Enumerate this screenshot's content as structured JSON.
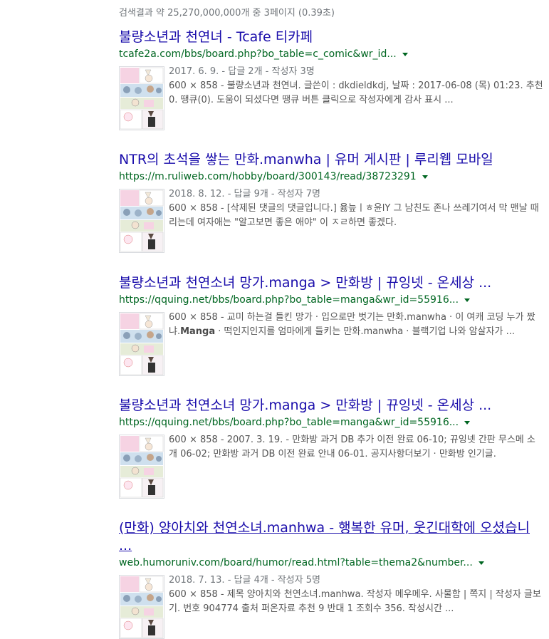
{
  "stats": "검색결과 약 25,270,000,000개 중 3페이지 (0.39초)",
  "results": [
    {
      "title": "불량소년과 천연녀 - Tcafe 티카페",
      "url": "tcafe2a.com/bbs/board.php?bo_table=c_comic&wr_id...",
      "meta": "2017. 6. 9. - 답글 2개 - 작성자 3명",
      "snippet_pre": "600 × 858 - 불량소년과 천연녀. 글쓴이 : dkdieldkdj, 날짜 : 2017-06-08 (목) 01:23. 추천0. 땡큐(0). 도움이 되셨다면 땡큐 버튼 클릭으로 작성자에게 감사 표시 ...",
      "snippet_bold": "",
      "snippet_post": ""
    },
    {
      "title": "NTR의 초석을 쌓는 만화.manwha | 유머 게시판 | 루리웹 모바일",
      "url": "https://m.ruliweb.com/hobby/board/300143/read/38723291",
      "meta": "2018. 8. 12. - 답글 9개 - 작성자 7명",
      "snippet_pre": "600 × 858 - [삭제된 댓글의 댓글입니다.] 윯늪ㅣㅎ윤lY 그 남친도 존나 쓰레기여서 막 맨날 때리는데 여자애는 \"알고보면 좋은 애야\" 이 ㅈㄹ하면 좋겠다.",
      "snippet_bold": "",
      "snippet_post": ""
    },
    {
      "title": "불량소년과 천연소녀 망가.manga > 만화방 | 뀨잉넷 - 온세상 ...",
      "url": "https://qquing.net/bbs/board.php?bo_table=manga&wr_id=55916...",
      "meta": "",
      "snippet_pre": "600 × 858 - 교미 하는걸 들킨 망가 · 입으로만 벗기는 만화.manwha · 이 여캐 코딩 누가 짰냐.",
      "snippet_bold": "Manga",
      "snippet_post": " · 떡인지인지를 엄마에게 들키는 만화.manwha · 블랙기업 나와 암살자가 ..."
    },
    {
      "title": "불량소년과 천연소녀 망가.manga > 만화방 | 뀨잉넷 - 온세상 ...",
      "url": "https://qquing.net/bbs/board.php?bo_table=manga&wr_id=55916...",
      "meta": "",
      "snippet_pre": "600 × 858 - 2007. 3. 19. - 만화방 과거 DB 추가 이전 완료 06-10; 뀨잉넷 간판 무스메 소개 06-02; 만화방 과거 DB 이전 완료 안내 06-01. 공지사항더보기 · 만화방 인기글.",
      "snippet_bold": "",
      "snippet_post": ""
    },
    {
      "title": "(만화) 양아치와 천연소녀.manhwa - 행복한 유머, 웃긴대학에 오셨습니 ...",
      "url": "web.humoruniv.com/board/humor/read.html?table=thema2&number...",
      "meta": "2018. 7. 13. - 답글 4개 - 작성자 5명",
      "snippet_pre": "600 × 858 - 제목 양아치와 천연소녀.manhwa. 작성자 메우메우. 사물함 | 쪽지 | 작성자 글보기. 번호 904774 출처 퍼온자료 추천 9 반대 1 조회수 356. 작성시간 ...",
      "snippet_bold": "",
      "snippet_post": ""
    }
  ],
  "colors": {
    "title": "#1a0dab",
    "url": "#006621",
    "snippet": "#545454",
    "meta": "#70757a"
  }
}
